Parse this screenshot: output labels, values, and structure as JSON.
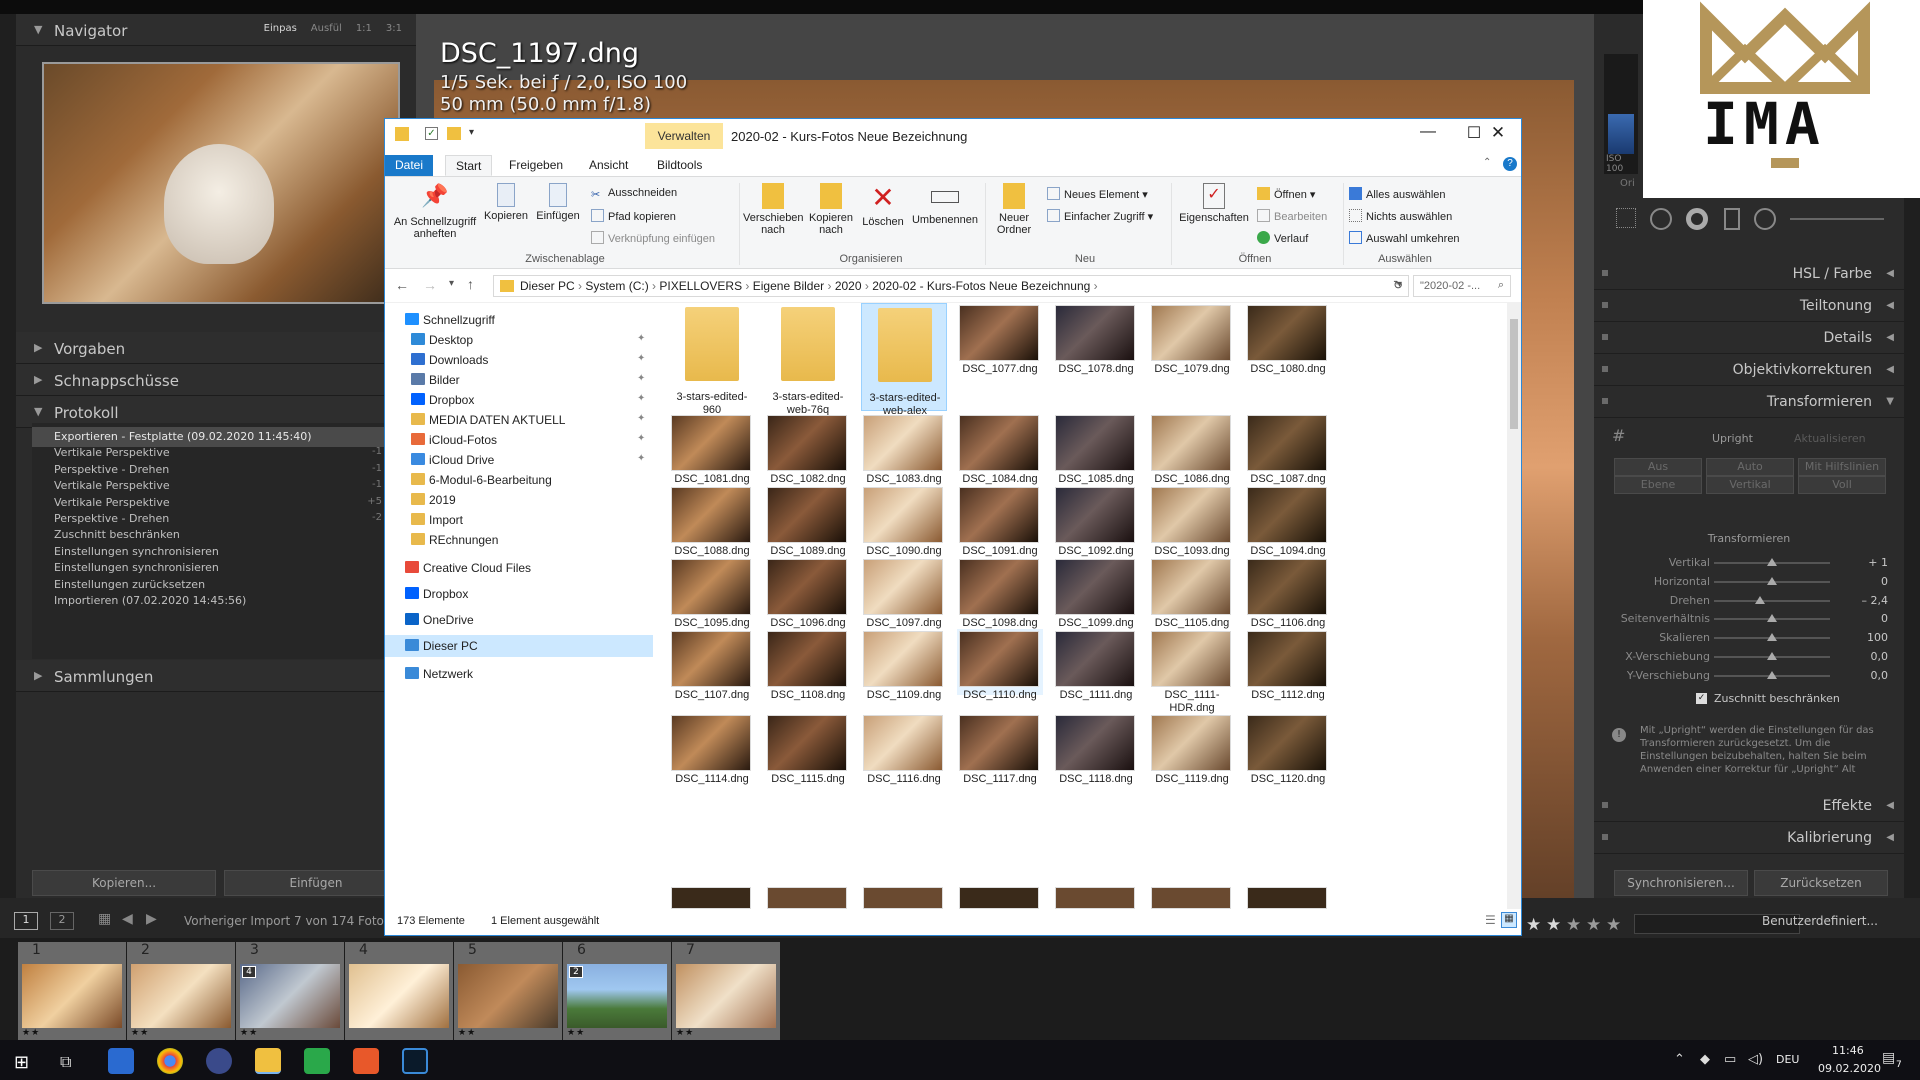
{
  "lightroom": {
    "navigator": {
      "title": "Navigator",
      "opts": [
        "Einpas",
        "Ausfül",
        "1:1",
        "3:1"
      ]
    },
    "panels": {
      "vorgaben": "Vorgaben",
      "schnappschuesse": "Schnappschüsse",
      "protokoll": "Protokoll",
      "sammlungen": "Sammlungen"
    },
    "history": [
      {
        "label": "Exportieren - Festplatte (09.02.2020 11:45:40)",
        "num": "",
        "selected": true
      },
      {
        "label": "Vertikale Perspektive",
        "num": "-1"
      },
      {
        "label": "Perspektive - Drehen",
        "num": "-1"
      },
      {
        "label": "Vertikale Perspektive",
        "num": "-1"
      },
      {
        "label": "Vertikale Perspektive",
        "num": "+5"
      },
      {
        "label": "Perspektive - Drehen",
        "num": "-2"
      },
      {
        "label": "Zuschnitt beschränken",
        "num": ""
      },
      {
        "label": "Einstellungen synchronisieren",
        "num": ""
      },
      {
        "label": "Einstellungen synchronisieren",
        "num": ""
      },
      {
        "label": "Einstellungen zurücksetzen",
        "num": ""
      },
      {
        "label": "Importieren (07.02.2020 14:45:56)",
        "num": ""
      }
    ],
    "left_buttons": {
      "copy": "Kopieren...",
      "paste": "Einfügen"
    },
    "photo": {
      "title": "DSC_1197.dng",
      "line2": "1/5 Sek. bei ƒ / 2,0, ISO 100",
      "line3": "50 mm (50.0 mm f/1.8)"
    },
    "right_panels": {
      "hsl": "HSL / Farbe",
      "teiltonung": "Teiltonung",
      "details": "Details",
      "objektiv": "Objektivkorrekturen",
      "transformieren": "Transformieren",
      "effekte": "Effekte",
      "kalibrierung": "Kalibrierung",
      "iso": "ISO 100",
      "orig": "Ori"
    },
    "transform": {
      "upright": "Upright",
      "aktualisieren": "Aktualisieren",
      "seg1": [
        "Aus",
        "Auto",
        "Mit Hilfslinien"
      ],
      "seg2": [
        "Ebene",
        "Vertikal",
        "Voll"
      ],
      "section": "Transformieren",
      "sliders": [
        {
          "label": "Vertikal",
          "value": "+ 1",
          "pos": 0.5
        },
        {
          "label": "Horizontal",
          "value": "0",
          "pos": 0.5
        },
        {
          "label": "Drehen",
          "value": "– 2,4",
          "pos": 0.4
        },
        {
          "label": "Seitenverhältnis",
          "value": "0",
          "pos": 0.5
        },
        {
          "label": "Skalieren",
          "value": "100",
          "pos": 0.5
        },
        {
          "label": "X-Verschiebung",
          "value": "0,0",
          "pos": 0.5
        },
        {
          "label": "Y-Verschiebung",
          "value": "0,0",
          "pos": 0.5
        }
      ],
      "constrain": "Zuschnitt beschränken",
      "info": "Mit „Upright“ werden die Einstellungen für das Transformieren zurückgesetzt. Um die Einstellungen beizubehalten, halten Sie beim Anwenden einer Korrektur für „Upright“ Alt"
    },
    "right_buttons": {
      "sync": "Synchronisieren...",
      "reset": "Zurücksetzen"
    },
    "toolbar": {
      "prev_import": "Vorheriger Import",
      "count": "7 von 174 Fotos",
      "custom": "Benutzerdefiniert...",
      "pages": [
        "1",
        "2"
      ]
    },
    "filmstrip": [
      {
        "n": "1",
        "stars": "★★",
        "badge": ""
      },
      {
        "n": "2",
        "stars": "★★",
        "badge": ""
      },
      {
        "n": "3",
        "stars": "★★",
        "badge": "4"
      },
      {
        "n": "4",
        "stars": "",
        "badge": ""
      },
      {
        "n": "5",
        "stars": "★★",
        "badge": ""
      },
      {
        "n": "6",
        "stars": "★★",
        "badge": "2"
      },
      {
        "n": "7",
        "stars": "★★",
        "badge": ""
      }
    ]
  },
  "explorer": {
    "title": "2020-02 - Kurs-Fotos Neue Bezeichnung",
    "verwalten": "Verwalten",
    "tabs": [
      "Datei",
      "Start",
      "Freigeben",
      "Ansicht",
      "Bildtools"
    ],
    "ribbon": {
      "pin": "An Schnellzugriff anheften",
      "copy": "Kopieren",
      "paste": "Einfügen",
      "cut": "Ausschneiden",
      "copypath": "Pfad kopieren",
      "pasteshortcut": "Verknüpfung einfügen",
      "grp_clip": "Zwischenablage",
      "move": "Verschieben nach",
      "copyto": "Kopieren nach",
      "delete": "Löschen",
      "rename": "Umbenennen",
      "grp_org": "Organisieren",
      "newfolder": "Neuer Ordner",
      "newitem": "Neues Element",
      "easy": "Einfacher Zugriff",
      "grp_new": "Neu",
      "props": "Eigenschaften",
      "open": "Öffnen",
      "edit": "Bearbeiten",
      "history": "Verlauf",
      "grp_open": "Öffnen",
      "selall": "Alles auswählen",
      "selnone": "Nichts auswählen",
      "selinv": "Auswahl umkehren",
      "grp_sel": "Auswählen"
    },
    "path": [
      "Dieser PC",
      "System (C:)",
      "PIXELLOVERS",
      "Eigene Bilder",
      "2020",
      "2020-02 - Kurs-Fotos Neue Bezeichnung"
    ],
    "search": "\"2020-02 -...",
    "nav": [
      {
        "label": "Schnellzugriff",
        "icon": "star-icon",
        "color": "#1e90ff",
        "pin": false,
        "indent": 0
      },
      {
        "label": "Desktop",
        "icon": "desktop-icon",
        "color": "#2e8ad8",
        "pin": true,
        "indent": 1
      },
      {
        "label": "Downloads",
        "icon": "download-icon",
        "color": "#2e6fd0",
        "pin": true,
        "indent": 1
      },
      {
        "label": "Bilder",
        "icon": "pictures-icon",
        "color": "#5a7aa8",
        "pin": true,
        "indent": 1
      },
      {
        "label": "Dropbox",
        "icon": "dropbox-icon",
        "color": "#0061fe",
        "pin": true,
        "indent": 1
      },
      {
        "label": "MEDIA DATEN AKTUELL",
        "icon": "folder-icon",
        "color": "#e8b94c",
        "pin": true,
        "indent": 1
      },
      {
        "label": "iCloud-Fotos",
        "icon": "icloud-photos-icon",
        "color": "#e86a3a",
        "pin": true,
        "indent": 1
      },
      {
        "label": "iCloud Drive",
        "icon": "icloud-icon",
        "color": "#3a8ae0",
        "pin": true,
        "indent": 1
      },
      {
        "label": "6-Modul-6-Bearbeitung",
        "icon": "folder-icon",
        "color": "#e8b94c",
        "pin": false,
        "indent": 1
      },
      {
        "label": "2019",
        "icon": "folder-icon",
        "color": "#e8b94c",
        "pin": false,
        "indent": 1
      },
      {
        "label": "Import",
        "icon": "folder-icon",
        "color": "#e8b94c",
        "pin": false,
        "indent": 1
      },
      {
        "label": "REchnungen",
        "icon": "folder-icon",
        "color": "#e8b94c",
        "pin": false,
        "indent": 1
      },
      {
        "label": "Creative Cloud Files",
        "icon": "creative-cloud-icon",
        "color": "#e84a3a",
        "pin": false,
        "indent": 0
      },
      {
        "label": "Dropbox",
        "icon": "dropbox-icon",
        "color": "#0061fe",
        "pin": false,
        "indent": 0
      },
      {
        "label": "OneDrive",
        "icon": "onedrive-icon",
        "color": "#0a64c8",
        "pin": false,
        "indent": 0
      },
      {
        "label": "Dieser PC",
        "icon": "pc-icon",
        "color": "#3a8ad8",
        "pin": false,
        "indent": 0,
        "selected": true
      },
      {
        "label": "Netzwerk",
        "icon": "network-icon",
        "color": "#3a8ad8",
        "pin": false,
        "indent": 0
      }
    ],
    "files": [
      {
        "name": "3-stars-edited-960",
        "type": "folder"
      },
      {
        "name": "3-stars-edited-web-76q",
        "type": "folder"
      },
      {
        "name": "3-stars-edited-web-alex",
        "type": "folder",
        "selected": true
      },
      {
        "name": "DSC_1077.dng"
      },
      {
        "name": "DSC_1078.dng"
      },
      {
        "name": "DSC_1079.dng"
      },
      {
        "name": "DSC_1080.dng"
      },
      {
        "name": "DSC_1081.dng"
      },
      {
        "name": "DSC_1082.dng"
      },
      {
        "name": "DSC_1083.dng"
      },
      {
        "name": "DSC_1084.dng"
      },
      {
        "name": "DSC_1085.dng"
      },
      {
        "name": "DSC_1086.dng"
      },
      {
        "name": "DSC_1087.dng"
      },
      {
        "name": "DSC_1088.dng"
      },
      {
        "name": "DSC_1089.dng"
      },
      {
        "name": "DSC_1090.dng"
      },
      {
        "name": "DSC_1091.dng"
      },
      {
        "name": "DSC_1092.dng"
      },
      {
        "name": "DSC_1093.dng"
      },
      {
        "name": "DSC_1094.dng"
      },
      {
        "name": "DSC_1095.dng"
      },
      {
        "name": "DSC_1096.dng"
      },
      {
        "name": "DSC_1097.dng"
      },
      {
        "name": "DSC_1098.dng"
      },
      {
        "name": "DSC_1099.dng"
      },
      {
        "name": "DSC_1105.dng"
      },
      {
        "name": "DSC_1106.dng"
      },
      {
        "name": "DSC_1107.dng"
      },
      {
        "name": "DSC_1108.dng"
      },
      {
        "name": "DSC_1109.dng"
      },
      {
        "name": "DSC_1110.dng",
        "hover": true
      },
      {
        "name": "DSC_1111.dng"
      },
      {
        "name": "DSC_1111-HDR.dng"
      },
      {
        "name": "DSC_1112.dng"
      },
      {
        "name": "DSC_1114.dng"
      },
      {
        "name": "DSC_1115.dng"
      },
      {
        "name": "DSC_1116.dng"
      },
      {
        "name": "DSC_1117.dng"
      },
      {
        "name": "DSC_1118.dng"
      },
      {
        "name": "DSC_1119.dng"
      },
      {
        "name": "DSC_1120.dng"
      }
    ],
    "status": {
      "count": "173 Elemente",
      "selected": "1 Element ausgewählt"
    }
  },
  "taskbar": {
    "lang": "DEU",
    "time": "11:46",
    "date": "09.02.2020",
    "notif": "7"
  },
  "logo": {
    "text": "IMA"
  }
}
